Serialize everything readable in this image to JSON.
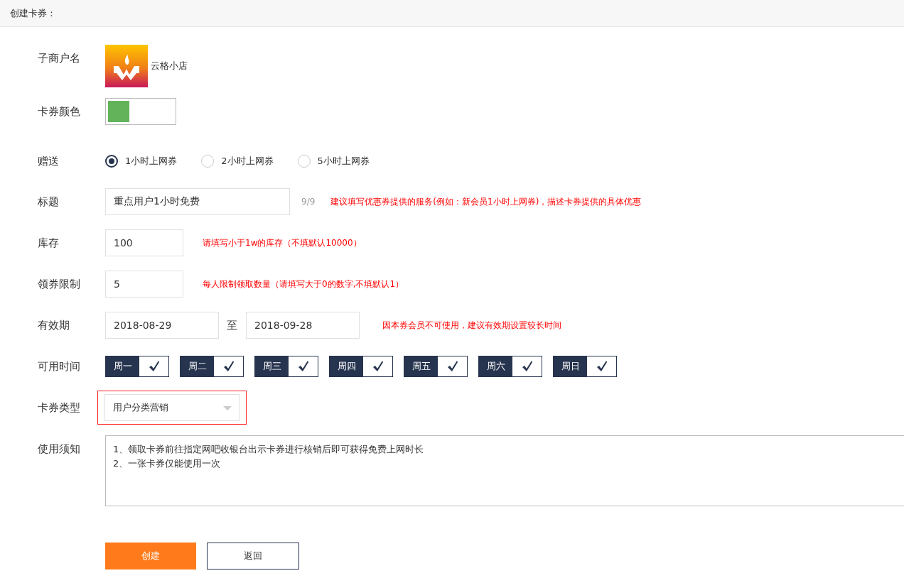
{
  "header": {
    "title": "创建卡券："
  },
  "merchant": {
    "label": "子商户名",
    "name": "云格小店"
  },
  "card_color": {
    "label": "卡券颜色",
    "color": "#62b35a"
  },
  "gift": {
    "label": "赠送",
    "options": [
      {
        "label": "1小时上网券",
        "selected": true
      },
      {
        "label": "2小时上网券",
        "selected": false
      },
      {
        "label": "5小时上网券",
        "selected": false
      }
    ]
  },
  "title_field": {
    "label": "标题",
    "value": "重点用户1小时免费",
    "counter": "9/9",
    "hint": "建议填写优惠券提供的服务(例如：新会员1小时上网券)，描述卡券提供的具体优惠"
  },
  "stock": {
    "label": "库存",
    "value": "100",
    "hint": "请填写小于1w的库存（不填默认10000）"
  },
  "limit": {
    "label": "领券限制",
    "value": "5",
    "hint": "每人限制领取数量（请填写大于0的数字,不填默认1）"
  },
  "validity": {
    "label": "有效期",
    "start": "2018-08-29",
    "separator": "至",
    "end": "2018-09-28",
    "hint": "因本券会员不可使用，建议有效期设置较长时间"
  },
  "available_days": {
    "label": "可用时间",
    "days": [
      {
        "label": "周一",
        "checked": true
      },
      {
        "label": "周二",
        "checked": true
      },
      {
        "label": "周三",
        "checked": true
      },
      {
        "label": "周四",
        "checked": true
      },
      {
        "label": "周五",
        "checked": true
      },
      {
        "label": "周六",
        "checked": true
      },
      {
        "label": "周日",
        "checked": true
      }
    ]
  },
  "card_type": {
    "label": "卡券类型",
    "value": "用户分类营销",
    "highlighted": true
  },
  "notes": {
    "label": "使用须知",
    "value": "1、领取卡券前往指定网吧收银台出示卡券进行核销后即可获得免费上网时长\n2、一张卡券仅能使用一次"
  },
  "buttons": [
    {
      "label": "创建",
      "kind": "primary"
    },
    {
      "label": "返回",
      "kind": "secondary"
    }
  ]
}
